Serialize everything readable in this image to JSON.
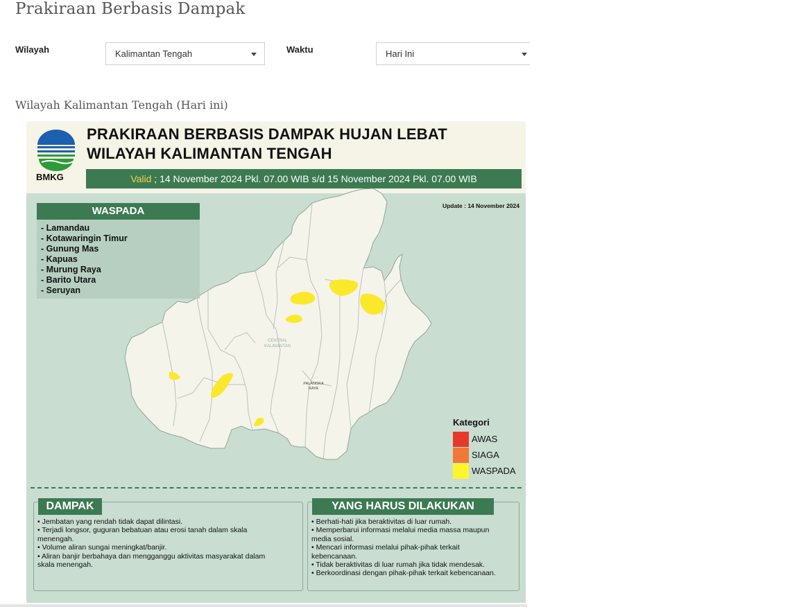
{
  "page": {
    "title": "Prakiraan Berbasis Dampak"
  },
  "filters": {
    "wilayah": {
      "label": "Wilayah",
      "value": "Kalimantan Tengah"
    },
    "waktu": {
      "label": "Waktu",
      "value": "Hari Ini"
    }
  },
  "subtitle": "Wilayah Kalimantan Tengah (Hari ini)",
  "infographic": {
    "logo_text": "BMKG",
    "title_line1": "PRAKIRAAN BERBASIS DAMPAK HUJAN LEBAT",
    "title_line2": "WILAYAH KALIMANTAN TENGAH",
    "valid_label": "Valid",
    "valid_text": " ; 14 November 2024 Pkl. 07.00 WIB s/d 15 November 2024 Pkl. 07.00 WIB",
    "update": "Update : 14 November 2024",
    "waspada_title": "WASPADA",
    "waspada_regions": [
      "- Lamandau",
      "- Kotawaringin Timur",
      "- Gunung Mas",
      "- Kapuas",
      "- Murung Raya",
      "- Barito Utara",
      "- Seruyan"
    ],
    "map_labels": {
      "province_line1": "CENTRAL",
      "province_line2": "KALIMANTAN",
      "city_line1": "PALANGKA",
      "city_line2": "RAYA"
    },
    "legend": {
      "title": "Kategori",
      "items": [
        {
          "label": "AWAS",
          "color": "#e53a2b"
        },
        {
          "label": "SIAGA",
          "color": "#ef7a36"
        },
        {
          "label": "WASPADA",
          "color": "#fff52e"
        }
      ]
    },
    "colors": {
      "header_green": "#3c7a52",
      "map_land": "#f5f4ea",
      "background": "#c9ddd1",
      "warning_yellow": "#fbe82a"
    },
    "dampak": {
      "title": "DAMPAK",
      "lines": [
        "• Jembatan yang rendah tidak dapat dilintasi.",
        "• Terjadi longsor, guguran bebatuan atau erosi tanah dalam skala",
        "menengah.",
        "• Volume aliran sungai meningkat/banjir.",
        "• Aliran banjir berbahaya dan mengganggu aktivitas masyarakat dalam",
        "skala menengah."
      ]
    },
    "yang_harus": {
      "title": "YANG HARUS DILAKUKAN",
      "lines": [
        "• Berhati-hati jika beraktivitas di luar rumah.",
        "• Memperbarui informasi melalui media massa maupun",
        "media sosial.",
        "• Mencari informasi melalui pihak-pihak terkait",
        "kebencanaan.",
        "• Tidak beraktivitas di luar rumah jika tidak mendesak.",
        "• Berkoordinasi dengan pihak-pihak terkait kebencanaan."
      ]
    }
  }
}
